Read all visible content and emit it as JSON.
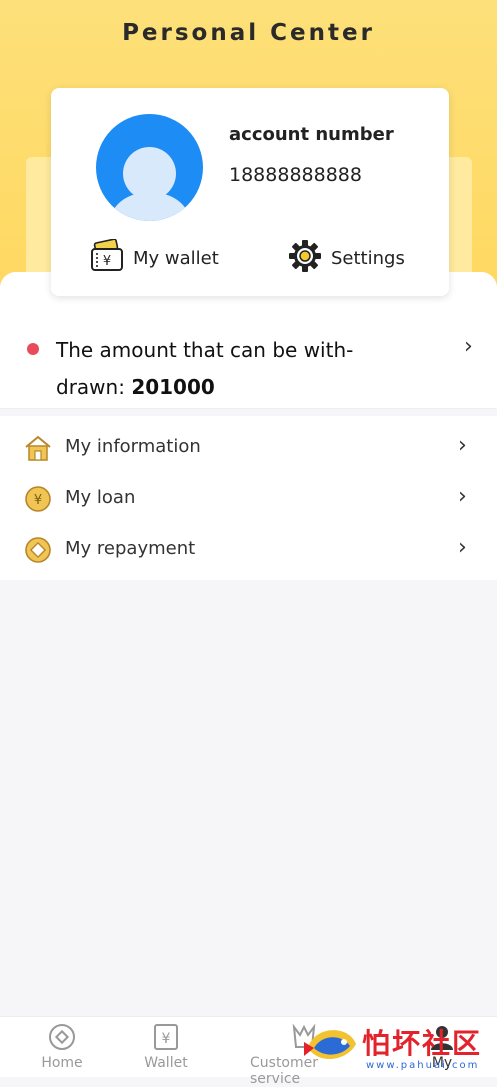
{
  "header": {
    "title": "Personal Center"
  },
  "profile": {
    "account_label": "account number",
    "account_value": "18888888888",
    "wallet_label": "My wallet",
    "settings_label": "Settings"
  },
  "withdraw": {
    "label_prefix": "The amount that can be with-drawn: ",
    "amount": "201000"
  },
  "menu": {
    "items": [
      {
        "label": "My information",
        "icon": "house-icon"
      },
      {
        "label": "My loan",
        "icon": "yen-coin-icon"
      },
      {
        "label": "My repayment",
        "icon": "coin-icon"
      }
    ]
  },
  "tabbar": {
    "tabs": [
      {
        "label": "Home",
        "icon": "home-compass-icon"
      },
      {
        "label": "Wallet",
        "icon": "yen-receipt-icon"
      },
      {
        "label": "Customer service",
        "icon": "customer-service-icon"
      },
      {
        "label": "My",
        "icon": "user-icon"
      }
    ]
  },
  "watermark": {
    "text": "怕坏社区",
    "url": "www.pahuai.com"
  },
  "colors": {
    "header_yellow": "#ffd860",
    "avatar_blue": "#1e8cf5",
    "dot_red": "#e84c5a",
    "icon_gold": "#e9b949"
  }
}
